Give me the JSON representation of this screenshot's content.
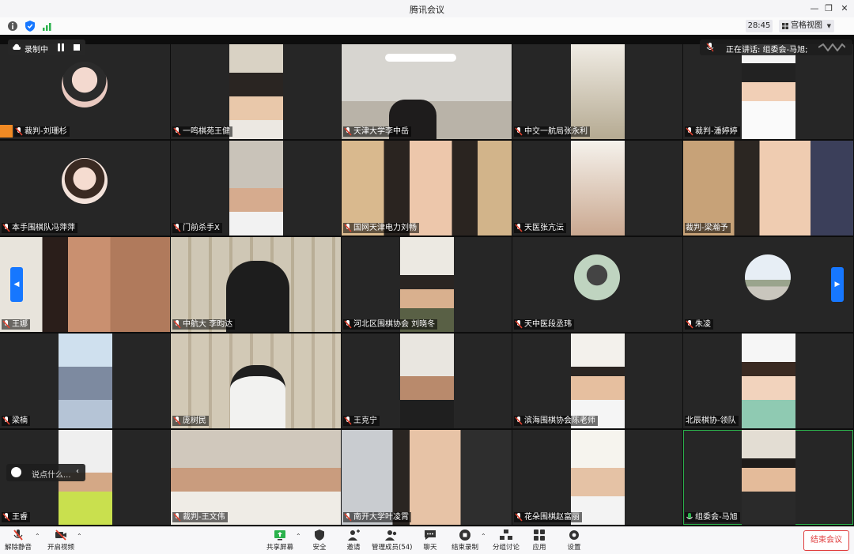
{
  "window": {
    "title": "腾讯会议",
    "min": "—",
    "restore": "❐",
    "close": "✕"
  },
  "info": {
    "timer": "28:45",
    "view_label": "宫格视图"
  },
  "recording": {
    "label": "录制中"
  },
  "speaking": {
    "label": "正在讲话: 组委会-马旭;"
  },
  "chat": {
    "placeholder": "说点什么..."
  },
  "tiles": [
    {
      "name": "裁判-刘珊杉"
    },
    {
      "name": "一鸣棋苑王健"
    },
    {
      "name": "天津大学李中岳"
    },
    {
      "name": "中交一航局张永利"
    },
    {
      "name": "裁判-潘婷婷"
    },
    {
      "name": "本手围棋队冯萍萍"
    },
    {
      "name": "门前杀手X"
    },
    {
      "name": "国网天津电力刘畅"
    },
    {
      "name": "天医张亢沄"
    },
    {
      "name": "裁判-梁瀚予"
    },
    {
      "name": "王娜"
    },
    {
      "name": "中航大 李昀达"
    },
    {
      "name": "河北区围棋协会 刘晓冬"
    },
    {
      "name": "天中医段丞玮"
    },
    {
      "name": "朱凌"
    },
    {
      "name": "梁楠"
    },
    {
      "name": "庞树民"
    },
    {
      "name": "王克宁"
    },
    {
      "name": "滨海围棋协会陈老师"
    },
    {
      "name": "北辰棋协-领队"
    },
    {
      "name": "王睿"
    },
    {
      "name": "裁判-王文伟"
    },
    {
      "name": "南开大学叶凌霄"
    },
    {
      "name": "花朵围棋赵富丽"
    },
    {
      "name": "组委会-马旭"
    }
  ],
  "toolbar": {
    "unmute": "解除静音",
    "video": "开启视频",
    "share": "共享屏幕",
    "security": "安全",
    "invite": "邀请",
    "members": "管理成员(54)",
    "chat": "聊天",
    "stop_record": "结束录制",
    "breakout": "分组讨论",
    "apps": "应用",
    "settings": "设置",
    "end": "结束会议"
  },
  "colors": {
    "accent": "#1677ff",
    "end_red": "#e03e3e",
    "mic_red": "#e2412e",
    "mic_green": "#2bb24c"
  }
}
